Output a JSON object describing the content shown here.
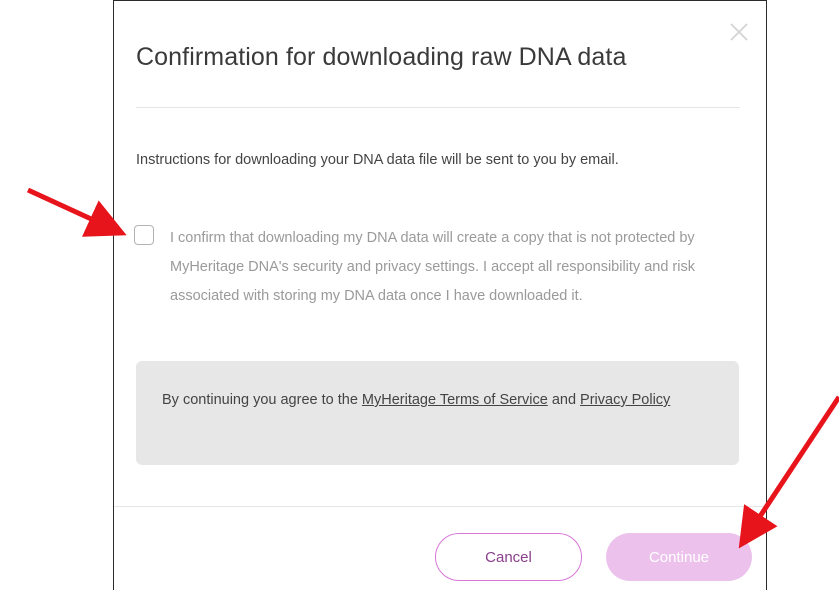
{
  "dialog": {
    "title": "Confirmation for downloading raw DNA data",
    "close_icon": "close-icon",
    "instructions": "Instructions for downloading your DNA data file will be sent to you by email.",
    "confirm_checkbox": {
      "checked": false,
      "label": "I confirm that downloading my DNA data will create a copy that is not protected by MyHeritage DNA's security and privacy settings. I accept all responsibility and risk associated with storing my DNA data once I have downloaded it."
    },
    "terms": {
      "prefix": "By continuing you agree to the ",
      "terms_link": "MyHeritage Terms of Service",
      "middle": " and ",
      "privacy_link": "Privacy Policy"
    },
    "buttons": {
      "cancel": "Cancel",
      "continue": "Continue",
      "continue_enabled": false
    }
  },
  "colors": {
    "annotation_arrow": "#e8141c",
    "accent": "#d877d8",
    "continue_disabled_bg": "#ecc2ec",
    "terms_box_bg": "#e7e7e7"
  }
}
